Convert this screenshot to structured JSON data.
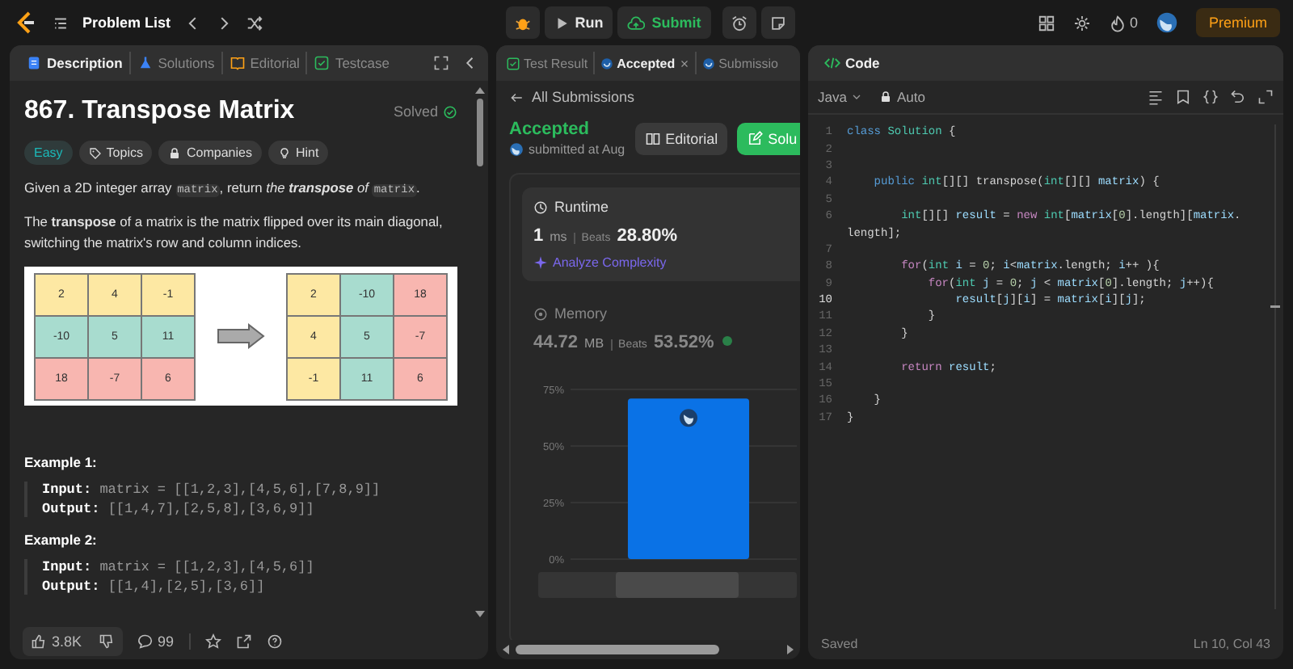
{
  "top_bar": {
    "problem_list": "Problem List",
    "run": "Run",
    "submit": "Submit",
    "streak": "0",
    "premium": "Premium"
  },
  "left_panel": {
    "tabs": [
      {
        "label": "Description",
        "kind": "description",
        "selected": true
      },
      {
        "label": "Solutions",
        "kind": "solutions",
        "selected": false
      },
      {
        "label": "Editorial",
        "kind": "editorial",
        "selected": false
      },
      {
        "label": "Testcase",
        "kind": "testcase",
        "selected": false
      }
    ],
    "title": "867. Transpose Matrix",
    "status": "Solved",
    "tags": [
      {
        "label": "Easy",
        "kind": "difficulty"
      },
      {
        "label": "Topics",
        "kind": "topics"
      },
      {
        "label": "Companies",
        "kind": "companies"
      },
      {
        "label": "Hint",
        "kind": "hint"
      }
    ],
    "paragraphs": [
      [
        {
          "kind": "plain",
          "text": "Given a 2D integer array "
        },
        {
          "kind": "code",
          "text": "matrix"
        },
        {
          "kind": "plain",
          "text": ", return "
        },
        {
          "kind": "italic",
          "text": "the "
        },
        {
          "kind": "bold-italic",
          "text": "transpose"
        },
        {
          "kind": "italic",
          "text": " of "
        },
        {
          "kind": "code",
          "text": "matrix"
        },
        {
          "kind": "plain",
          "text": "."
        }
      ],
      [
        {
          "kind": "plain",
          "text": "The "
        },
        {
          "kind": "bold",
          "text": "transpose"
        },
        {
          "kind": "plain",
          "text": " of a matrix is the matrix flipped over its main diagonal, switching the matrix's row and column indices."
        }
      ]
    ],
    "diagram": {
      "before": [
        [
          {
            "value": "2",
            "color": "#fde8a3"
          },
          {
            "value": "4",
            "color": "#fde8a3"
          },
          {
            "value": "-1",
            "color": "#fde8a3"
          }
        ],
        [
          {
            "value": "-10",
            "color": "#a8dccf"
          },
          {
            "value": "5",
            "color": "#a8dccf"
          },
          {
            "value": "11",
            "color": "#a8dccf"
          }
        ],
        [
          {
            "value": "18",
            "color": "#f8b6b0"
          },
          {
            "value": "-7",
            "color": "#f8b6b0"
          },
          {
            "value": "6",
            "color": "#f8b6b0"
          }
        ]
      ],
      "after": [
        [
          {
            "value": "2",
            "color": "#fde8a3"
          },
          {
            "value": "-10",
            "color": "#a8dccf"
          },
          {
            "value": "18",
            "color": "#f8b6b0"
          }
        ],
        [
          {
            "value": "4",
            "color": "#fde8a3"
          },
          {
            "value": "5",
            "color": "#a8dccf"
          },
          {
            "value": "-7",
            "color": "#f8b6b0"
          }
        ],
        [
          {
            "value": "-1",
            "color": "#fde8a3"
          },
          {
            "value": "11",
            "color": "#a8dccf"
          },
          {
            "value": "6",
            "color": "#f8b6b0"
          }
        ]
      ]
    },
    "examples": [
      {
        "title": "Example 1:",
        "input_label": "Input:",
        "input": "matrix = [[1,2,3],[4,5,6],[7,8,9]]",
        "output_label": "Output:",
        "output": "[[1,4,7],[2,5,8],[3,6,9]]"
      },
      {
        "title": "Example 2:",
        "input_label": "Input:",
        "input": "matrix = [[1,2,3],[4,5,6]]",
        "output_label": "Output:",
        "output": "[[1,4],[2,5],[3,6]]"
      }
    ],
    "footer": {
      "likes": "3.8K",
      "comments": "99"
    }
  },
  "middle_panel": {
    "tabs": [
      {
        "label": "Test Result",
        "kind": "result",
        "selected": false,
        "closable": false
      },
      {
        "label": "Accepted",
        "kind": "accepted",
        "selected": true,
        "closable": true
      },
      {
        "label": "Submissio",
        "kind": "submissions",
        "selected": false,
        "closable": false
      }
    ],
    "back_link": "All Submissions",
    "verdict": "Accepted",
    "submitted": "submitted at Aug",
    "buttons": [
      {
        "label": "Editorial",
        "kind": "secondary"
      },
      {
        "label": "Solu",
        "kind": "primary"
      }
    ],
    "metrics": [
      {
        "title": "Runtime",
        "kind": "runtime",
        "selected": true,
        "value": "1",
        "unit": "ms",
        "beats_label": "Beats",
        "beats": "28.80%",
        "analyze": "Analyze Complexity"
      },
      {
        "title": "Memory",
        "kind": "memory",
        "selected": false,
        "value": "44.72",
        "unit": "MB",
        "beats_label": "Beats",
        "beats": "53.52%"
      }
    ],
    "chart_data": {
      "type": "bar",
      "values": [
        71
      ],
      "ylim": [
        0,
        75
      ],
      "grid": true,
      "yticks": [
        {
          "value": 0,
          "label": "0%"
        },
        {
          "value": 25,
          "label": "25%"
        },
        {
          "value": 50,
          "label": "50%"
        },
        {
          "value": 75,
          "label": "75%"
        }
      ]
    }
  },
  "code_panel": {
    "title": "Code",
    "language": "Java",
    "mode": "Auto",
    "lines": [
      {
        "number": "1",
        "current": false,
        "tokens": [
          {
            "kind": "keyword",
            "text": "class "
          },
          {
            "kind": "type",
            "text": "Solution"
          },
          " {"
        ]
      },
      {
        "number": "2",
        "current": false
      },
      {
        "number": "3",
        "current": false
      },
      {
        "number": "4",
        "current": false,
        "tokens": [
          {
            "kind": "keyword",
            "text": "    public "
          },
          {
            "kind": "type",
            "text": "int"
          },
          "[][] transpose(",
          {
            "kind": "type",
            "text": "int"
          },
          "[][] ",
          {
            "kind": "variable",
            "text": "matrix"
          },
          ") {"
        ]
      },
      {
        "number": "5",
        "current": false
      },
      {
        "number": "6",
        "current": false,
        "tokens": [
          {
            "kind": "type",
            "text": "        int"
          },
          "[][] ",
          {
            "kind": "variable",
            "text": "result"
          },
          " = ",
          {
            "kind": "control",
            "text": "new "
          },
          {
            "kind": "type",
            "text": "int"
          },
          "[",
          {
            "kind": "variable",
            "text": "matrix"
          },
          "[",
          {
            "kind": "number",
            "text": "0"
          },
          "].length][",
          {
            "kind": "variable",
            "text": "matrix"
          },
          "."
        ]
      },
      {
        "tokens": [
          "length];"
        ]
      },
      {
        "number": "7",
        "current": false
      },
      {
        "number": "8",
        "current": false,
        "tokens": [
          {
            "kind": "control",
            "text": "        for"
          },
          "(",
          {
            "kind": "type",
            "text": "int "
          },
          {
            "kind": "variable",
            "text": "i"
          },
          " = ",
          {
            "kind": "number",
            "text": "0"
          },
          "; ",
          {
            "kind": "variable",
            "text": "i"
          },
          "<",
          {
            "kind": "variable",
            "text": "matrix"
          },
          ".length; ",
          {
            "kind": "variable",
            "text": "i"
          },
          "++ ){"
        ]
      },
      {
        "number": "9",
        "current": false,
        "tokens": [
          {
            "kind": "control",
            "text": "            for"
          },
          "(",
          {
            "kind": "type",
            "text": "int "
          },
          {
            "kind": "variable",
            "text": "j"
          },
          " = ",
          {
            "kind": "number",
            "text": "0"
          },
          "; ",
          {
            "kind": "variable",
            "text": "j"
          },
          " < ",
          {
            "kind": "variable",
            "text": "matrix"
          },
          "[",
          {
            "kind": "number",
            "text": "0"
          },
          "].length; ",
          {
            "kind": "variable",
            "text": "j"
          },
          "++){"
        ]
      },
      {
        "number": "10",
        "current": true,
        "tokens": [
          {
            "kind": "variable",
            "text": "                result"
          },
          "[",
          {
            "kind": "variable",
            "text": "j"
          },
          "][",
          {
            "kind": "variable",
            "text": "i"
          },
          "] = ",
          {
            "kind": "variable",
            "text": "matrix"
          },
          "[",
          {
            "kind": "variable",
            "text": "i"
          },
          "][",
          {
            "kind": "variable",
            "text": "j"
          },
          "];"
        ]
      },
      {
        "number": "11",
        "current": false,
        "tokens": [
          "            }"
        ]
      },
      {
        "number": "12",
        "current": false,
        "tokens": [
          "        }"
        ]
      },
      {
        "number": "13",
        "current": false
      },
      {
        "number": "14",
        "current": false,
        "tokens": [
          {
            "kind": "control",
            "text": "        return "
          },
          {
            "kind": "variable",
            "text": "result"
          },
          ";"
        ]
      },
      {
        "number": "15",
        "current": false
      },
      {
        "number": "16",
        "current": false,
        "tokens": [
          "    }"
        ]
      },
      {
        "number": "17",
        "current": false,
        "tokens": [
          "}"
        ]
      }
    ],
    "status": "Saved",
    "cursor": "Ln 10, Col 43"
  }
}
